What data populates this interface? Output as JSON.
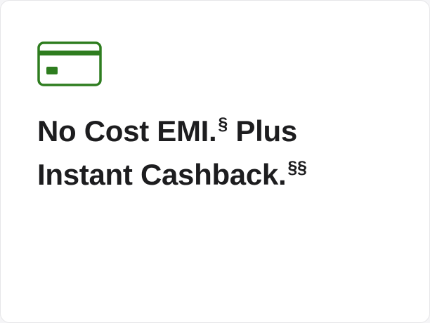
{
  "card": {
    "icon": "credit-card-icon",
    "accent_color": "#2e7d1f",
    "headline": {
      "line1": {
        "text_a": "No Cost EMI.",
        "sup_a": "§",
        "text_b": " Plus"
      },
      "line2": {
        "text_a": "Instant Cashback.",
        "sup_a": "§§"
      }
    }
  }
}
